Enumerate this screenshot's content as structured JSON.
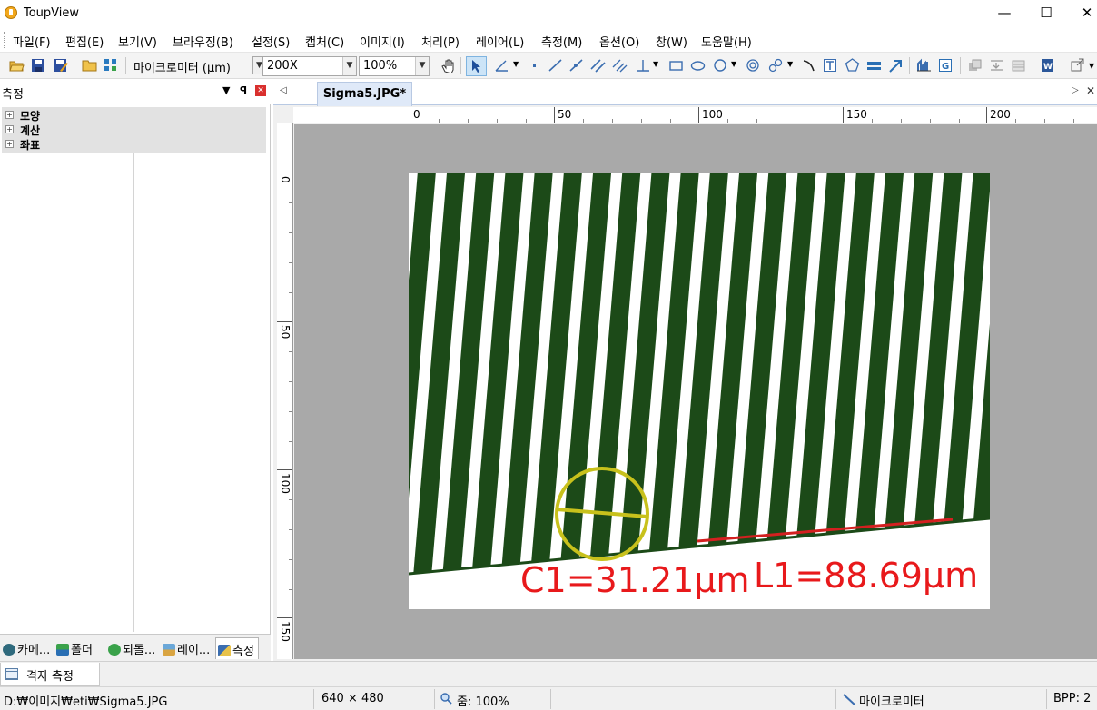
{
  "window": {
    "title": "ToupView",
    "minimize": "—",
    "maximize": "☐",
    "close": "✕"
  },
  "menu": [
    "파일(F)",
    "편집(E)",
    "보기(V)",
    "브라우징(B)",
    "설정(S)",
    "캡처(C)",
    "이미지(I)",
    "처리(P)",
    "레이어(L)",
    "측정(M)",
    "옵션(O)",
    "창(W)",
    "도움말(H)"
  ],
  "toolbar": {
    "unit_value": "마이크로미터 (µm)",
    "magnification_value": "200X",
    "zoom_value": "100%",
    "icons": [
      "open-folder-icon",
      "save-icon",
      "save-as-icon",
      "folder-icon",
      "grid-icon",
      "hand-icon",
      "pointer-icon",
      "angle-icon",
      "point-icon",
      "line-icon",
      "arrow-line-icon",
      "parallel-icon",
      "double-parallel-icon",
      "perpendicular-icon",
      "rectangle-icon",
      "ellipse-icon",
      "circle-icon",
      "concentric-circle-icon",
      "link-icon",
      "arc-icon",
      "text-icon",
      "polygon-icon",
      "scale-bar-icon",
      "arrow-icon",
      "calibration-icon",
      "export-icon"
    ]
  },
  "left_panel": {
    "title": "측정",
    "tree": [
      "모양",
      "계산",
      "좌표"
    ],
    "tabs": [
      "카메...",
      "폴더",
      "되돌...",
      "레이...",
      "측정"
    ]
  },
  "document": {
    "tab_label": "Sigma5.JPG*",
    "ruler_h_labels": [
      "0",
      "50",
      "100",
      "150",
      "200"
    ],
    "ruler_v_labels": [
      "0",
      "50",
      "100",
      "150"
    ],
    "measure_circle_label": "C1=31.21µm",
    "measure_line_label": "L1=88.69µm",
    "colors": {
      "stripe_dark": "#1c4a18",
      "stripe_light": "#ffffff",
      "circle": "#c8c11c",
      "line": "#d42020",
      "label": "#e8191b",
      "canvas_bg": "#a9a9a9"
    }
  },
  "grid_measure_tab": "격자 측정",
  "status": {
    "path": "D:₩이미지₩eti₩Sigma5.JPG",
    "dimensions": "640 × 480",
    "zoom": "줌: 100%",
    "unit": "마이크로미터",
    "bpp": "BPP: 2"
  }
}
